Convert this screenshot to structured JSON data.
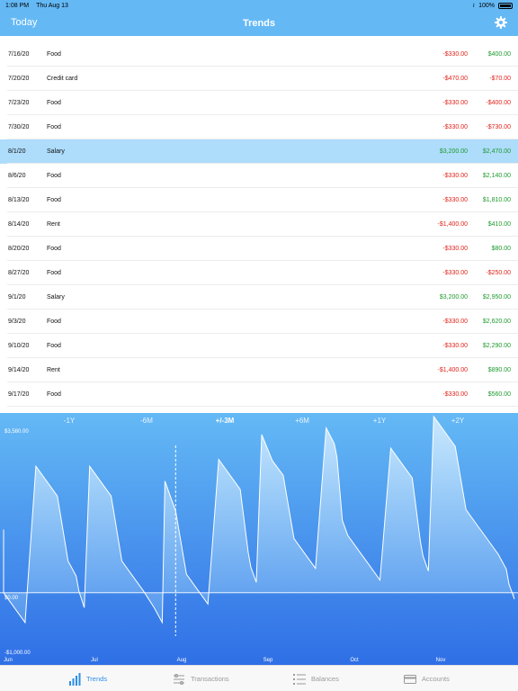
{
  "status": {
    "time": "1:08 PM",
    "date": "Thu Aug 13",
    "battery": "100%"
  },
  "nav": {
    "left": "Today",
    "title": "Trends",
    "settings_icon": "gear-icon"
  },
  "transactions": [
    {
      "date": "7/16/20",
      "desc": "Food",
      "amount": "-$330.00",
      "balance": "$400.00",
      "amount_sign": "neg",
      "balance_sign": "pos"
    },
    {
      "date": "7/20/20",
      "desc": "Credit card",
      "amount": "-$470.00",
      "balance": "-$70.00",
      "amount_sign": "neg",
      "balance_sign": "neg"
    },
    {
      "date": "7/23/20",
      "desc": "Food",
      "amount": "-$330.00",
      "balance": "-$400.00",
      "amount_sign": "neg",
      "balance_sign": "neg"
    },
    {
      "date": "7/30/20",
      "desc": "Food",
      "amount": "-$330.00",
      "balance": "-$730.00",
      "amount_sign": "neg",
      "balance_sign": "neg"
    },
    {
      "date": "8/1/20",
      "desc": "Salary",
      "amount": "$3,200.00",
      "balance": "$2,470.00",
      "amount_sign": "pos",
      "balance_sign": "pos",
      "selected": true
    },
    {
      "date": "8/6/20",
      "desc": "Food",
      "amount": "-$330.00",
      "balance": "$2,140.00",
      "amount_sign": "neg",
      "balance_sign": "pos"
    },
    {
      "date": "8/13/20",
      "desc": "Food",
      "amount": "-$330.00",
      "balance": "$1,810.00",
      "amount_sign": "neg",
      "balance_sign": "pos"
    },
    {
      "date": "8/14/20",
      "desc": "Rent",
      "amount": "-$1,400.00",
      "balance": "$410.00",
      "amount_sign": "neg",
      "balance_sign": "pos"
    },
    {
      "date": "8/20/20",
      "desc": "Food",
      "amount": "-$330.00",
      "balance": "$80.00",
      "amount_sign": "neg",
      "balance_sign": "pos"
    },
    {
      "date": "8/27/20",
      "desc": "Food",
      "amount": "-$330.00",
      "balance": "-$250.00",
      "amount_sign": "neg",
      "balance_sign": "neg"
    },
    {
      "date": "9/1/20",
      "desc": "Salary",
      "amount": "$3,200.00",
      "balance": "$2,950.00",
      "amount_sign": "pos",
      "balance_sign": "pos"
    },
    {
      "date": "9/3/20",
      "desc": "Food",
      "amount": "-$330.00",
      "balance": "$2,620.00",
      "amount_sign": "neg",
      "balance_sign": "pos"
    },
    {
      "date": "9/10/20",
      "desc": "Food",
      "amount": "-$330.00",
      "balance": "$2,290.00",
      "amount_sign": "neg",
      "balance_sign": "pos"
    },
    {
      "date": "9/14/20",
      "desc": "Rent",
      "amount": "-$1,400.00",
      "balance": "$890.00",
      "amount_sign": "neg",
      "balance_sign": "pos"
    },
    {
      "date": "9/17/20",
      "desc": "Food",
      "amount": "-$330.00",
      "balance": "$560.00",
      "amount_sign": "neg",
      "balance_sign": "pos"
    }
  ],
  "ranges": [
    {
      "label": "-1Y"
    },
    {
      "label": "-6M"
    },
    {
      "label": "+/-3M",
      "active": true
    },
    {
      "label": "+6M"
    },
    {
      "label": "+1Y"
    },
    {
      "label": "+2Y"
    }
  ],
  "chart_data": {
    "type": "area",
    "y_labels": [
      "$3,580.00",
      "$0.00",
      "-$1,000.00"
    ],
    "ylim": [
      -1000,
      3580
    ],
    "x_labels": [
      "Jun",
      "Jul",
      "Aug",
      "Sep",
      "Oct",
      "Nov"
    ],
    "series": [
      {
        "x": [
          0,
          0,
          4,
          8,
          12,
          16,
          20,
          24,
          27,
          28,
          30,
          32,
          36,
          40,
          44,
          48,
          52,
          56,
          59,
          60,
          62,
          64,
          68,
          72,
          76,
          80,
          84,
          88,
          91,
          92,
          94,
          96,
          100,
          104,
          108,
          112,
          116,
          120,
          123,
          124,
          126,
          128,
          132,
          136,
          140,
          144,
          148,
          152,
          155,
          156,
          158,
          160,
          164,
          168,
          172,
          176,
          180,
          184,
          187,
          188,
          190
        ],
        "values": [
          1400,
          0,
          -330,
          -660,
          2800,
          2470,
          2140,
          700,
          370,
          40,
          -330,
          2800,
          2470,
          2140,
          700,
          370,
          40,
          -330,
          -660,
          2470,
          2140,
          1810,
          410,
          80,
          -250,
          2950,
          2620,
          2290,
          890,
          560,
          230,
          3500,
          2920,
          2600,
          1200,
          870,
          540,
          3650,
          3300,
          3000,
          1600,
          1270,
          940,
          610,
          280,
          3200,
          2870,
          2540,
          1140,
          810,
          480,
          3900,
          3570,
          3240,
          1840,
          1510,
          1180,
          850,
          520,
          190,
          -140
        ]
      }
    ],
    "marker_x": 64,
    "colors": {
      "fill_top": "#cfe9ff",
      "fill_bottom": "#7bbcf4",
      "bg_top": "#64b9f5",
      "bg_bottom": "#2f6fe6",
      "line": "#ffffff"
    }
  },
  "tabs": [
    {
      "label": "Trends",
      "icon": "bar-chart-icon",
      "active": true
    },
    {
      "label": "Transactions",
      "icon": "transactions-icon"
    },
    {
      "label": "Balances",
      "icon": "list-icon"
    },
    {
      "label": "Accounts",
      "icon": "card-icon"
    }
  ]
}
